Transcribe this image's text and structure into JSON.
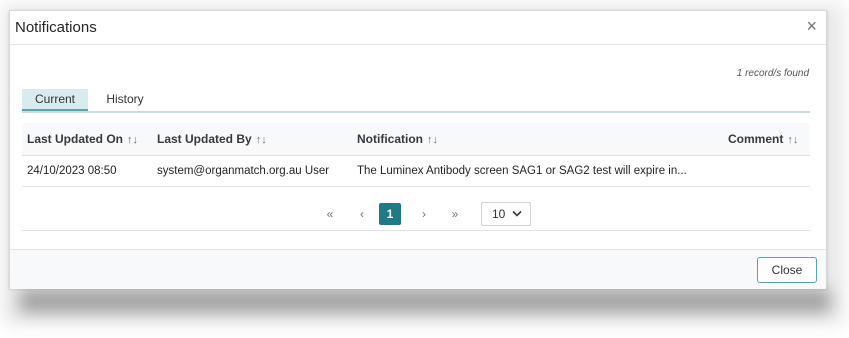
{
  "dialog": {
    "title": "Notifications",
    "close_icon": "×",
    "records_found": "1 record/s found"
  },
  "tabs": [
    {
      "label": "Current",
      "active": true
    },
    {
      "label": "History",
      "active": false
    }
  ],
  "table": {
    "sort_icon": "↑↓",
    "columns": [
      {
        "label": "Last Updated On"
      },
      {
        "label": "Last Updated By"
      },
      {
        "label": "Notification"
      },
      {
        "label": "Comment"
      }
    ],
    "rows": [
      {
        "last_updated_on": "24/10/2023 08:50",
        "last_updated_by": "system@organmatch.org.au User",
        "notification": "The Luminex Antibody screen SAG1 or SAG2 test will expire in...",
        "comment": ""
      }
    ]
  },
  "paginator": {
    "first": "«",
    "prev": "‹",
    "current_page": "1",
    "next": "›",
    "last": "»",
    "page_size": "10"
  },
  "footer": {
    "close_label": "Close"
  },
  "colors": {
    "accent": "#1f7a86",
    "tab_active_bg": "#d9ebee",
    "tab_underline": "#5aa3ac"
  }
}
